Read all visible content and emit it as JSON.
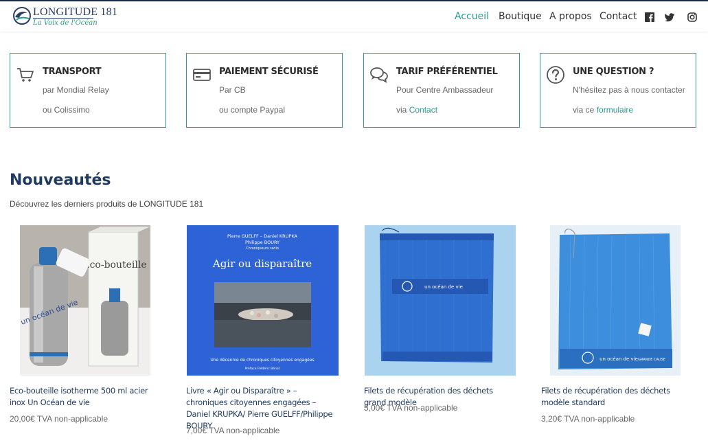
{
  "header": {
    "logo": {
      "title": "LONGITUDE 181",
      "subtitle": "La Voix de l'Océan"
    },
    "nav": [
      {
        "label": "Accueil",
        "active": true
      },
      {
        "label": "Boutique",
        "active": false
      },
      {
        "label": "A propos",
        "active": false
      },
      {
        "label": "Contact",
        "active": false
      }
    ],
    "social": [
      "facebook-icon",
      "twitter-icon",
      "instagram-icon"
    ],
    "accent_color": "#2a9d8f"
  },
  "features": [
    {
      "icon": "cart-icon",
      "title": "TRANSPORT",
      "line1": "par Mondial Relay",
      "line2": "ou Colissimo"
    },
    {
      "icon": "credit-card-icon",
      "title": "PAIEMENT SÉCURISÉ",
      "line1": "Par CB",
      "line2": "ou compte Paypal"
    },
    {
      "icon": "chat-bubbles-icon",
      "title": "TARIF PRÉFÉRENTIEL",
      "line1": "Pour Centre Ambassadeur",
      "line2_prefix": "via ",
      "line2_link": "Contact"
    },
    {
      "icon": "question-icon",
      "title": "UNE QUESTION ?",
      "line1": "N'hésitez pas à nous contacter",
      "line2_prefix": "via ce ",
      "line2_link": "formulaire"
    }
  ],
  "section": {
    "title": "Nouveautés",
    "subtitle": "Découvrez les derniers produits de LONGITUDE 181"
  },
  "products": [
    {
      "name": "Eco-bouteille isotherme 500 ml acier inox Un Océan de vie",
      "price": "20,00€ TVA non-applicable",
      "image": {
        "box_text": "Éco-bouteille",
        "bottle_text": "un océan de vie"
      }
    },
    {
      "name": "Livre « Agir ou Disparaître » – chroniques citoyennes engagées – Daniel KRUPKA/ Pierre GUELFF/Philippe BOURY",
      "price": "7,00€ TVA non-applicable",
      "image": {
        "authors_line1": "Pierre GUELFF – Daniel KRUPKA",
        "authors_line2": "Philippe BOURY",
        "role": "Chroniqueurs radio",
        "title": "Agir ou disparaître",
        "tagline": "Une décennie de chroniques citoyennes engagées",
        "preface": "Préface Frédéric Bénot"
      }
    },
    {
      "name": "Filets de récupération des déchets grand modèle",
      "price": "5,00€ TVA non-applicable",
      "image": {
        "print": "un océan de vie"
      }
    },
    {
      "name": "Filets de récupération des déchets modèle standard",
      "price": "3,20€ TVA non-applicable",
      "image": {
        "print": "un océan de vie",
        "brand": "GRANDE CAUSE"
      }
    }
  ]
}
